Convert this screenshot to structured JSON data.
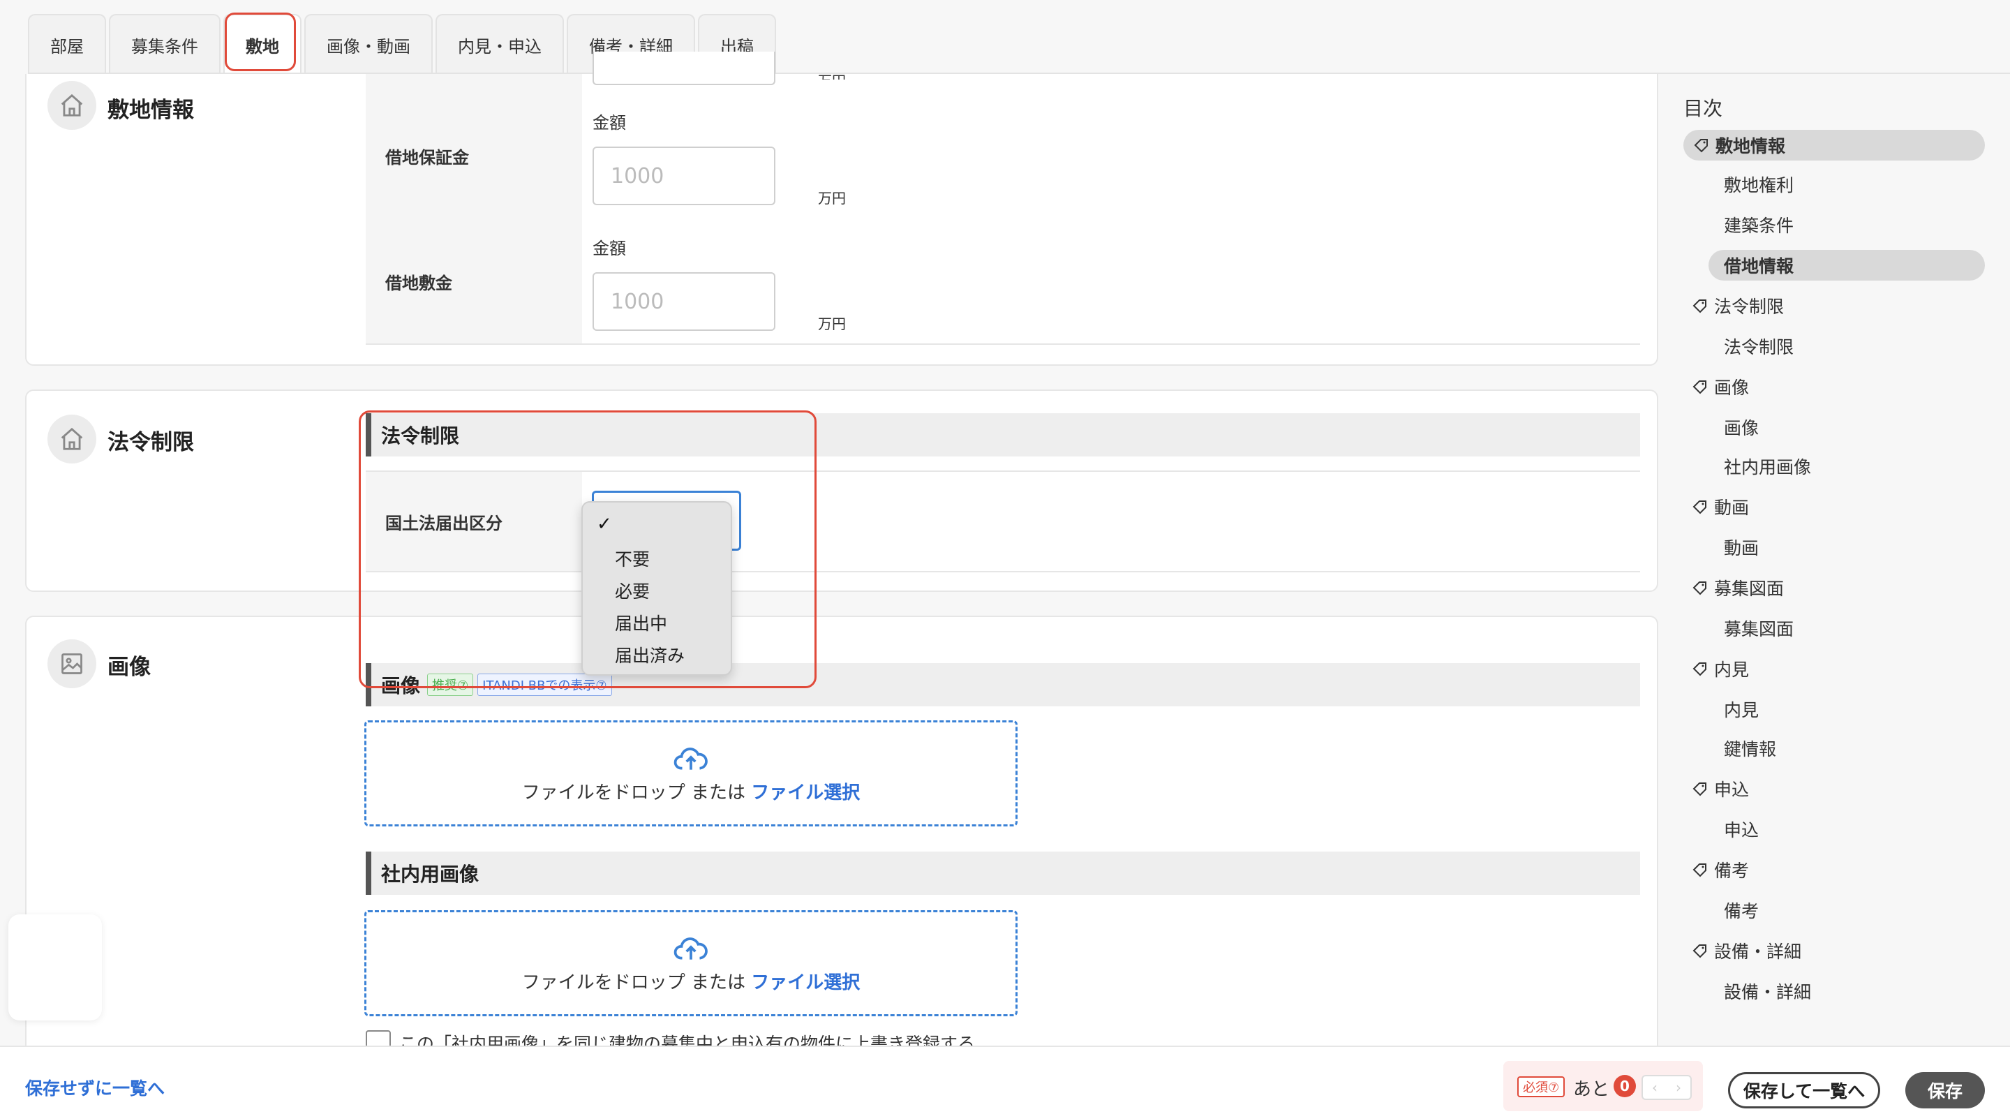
{
  "tabs": [
    "部屋",
    "募集条件",
    "敷地",
    "画像・動画",
    "内見・申込",
    "備考・詳細",
    "出稿"
  ],
  "active_tab": "敷地",
  "sections": {
    "site": {
      "title": "敷地情報",
      "top_unit": "万円",
      "fields": [
        {
          "label": "借地保証金",
          "sub_label": "金額",
          "placeholder": "1000",
          "unit": "万円"
        },
        {
          "label": "借地敷金",
          "sub_label": "金額",
          "placeholder": "1000",
          "unit": "万円"
        }
      ]
    },
    "law": {
      "title": "法令制限",
      "subsection": "法令制限",
      "field_label": "国土法届出区分",
      "selected": "",
      "options": [
        "不要",
        "必要",
        "届出中",
        "届出済み"
      ]
    },
    "image": {
      "title": "画像",
      "subsection": "画像",
      "badge_recommend": "推奨⑦",
      "badge_itandi": "ITANDI BBでの表示⑦",
      "drop_text": "ファイルをドロップ または",
      "drop_link": "ファイル選択",
      "internal_title": "社内用画像",
      "internal_drop_text": "ファイルをドロップ または",
      "internal_drop_link": "ファイル選択",
      "checkbox_label": "この「社内用画像」を同じ建物の募集中と申込有の物件に上書き登録する"
    }
  },
  "toc": {
    "title": "目次",
    "items": [
      {
        "label": "敷地情報",
        "level": 1,
        "active": true
      },
      {
        "label": "敷地権利",
        "level": 2
      },
      {
        "label": "建築条件",
        "level": 2
      },
      {
        "label": "借地情報",
        "level": 2,
        "active": true
      },
      {
        "label": "法令制限",
        "level": 1
      },
      {
        "label": "法令制限",
        "level": 2
      },
      {
        "label": "画像",
        "level": 1
      },
      {
        "label": "画像",
        "level": 2
      },
      {
        "label": "社内用画像",
        "level": 2
      },
      {
        "label": "動画",
        "level": 1
      },
      {
        "label": "動画",
        "level": 2
      },
      {
        "label": "募集図面",
        "level": 1
      },
      {
        "label": "募集図面",
        "level": 2
      },
      {
        "label": "内見",
        "level": 1
      },
      {
        "label": "内見",
        "level": 2
      },
      {
        "label": "鍵情報",
        "level": 2
      },
      {
        "label": "申込",
        "level": 1
      },
      {
        "label": "申込",
        "level": 2
      },
      {
        "label": "備考",
        "level": 1
      },
      {
        "label": "備考",
        "level": 2
      },
      {
        "label": "設備・詳細",
        "level": 1
      },
      {
        "label": "設備・詳細",
        "level": 2
      }
    ]
  },
  "footer": {
    "back_link": "保存せずに一覧へ",
    "required_badge": "必須⑦",
    "remaining_label": "あと",
    "remaining_count": "0",
    "save_and_list": "保存して一覧へ",
    "save": "保存"
  },
  "colors": {
    "accent": "#3b82d6",
    "highlight": "#e04a3a",
    "link": "#2f6fd6"
  }
}
